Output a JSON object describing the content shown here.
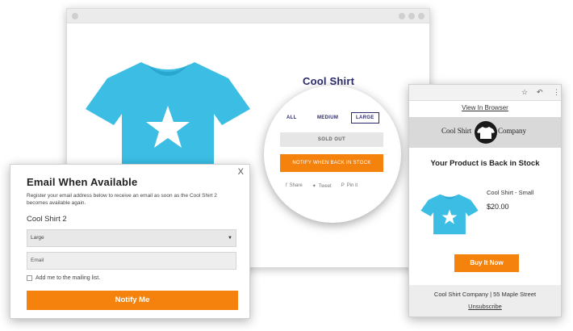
{
  "store": {
    "product_title": "Cool Shirt",
    "sizes": [
      "ALL",
      "MEDIUM",
      "LARGE"
    ],
    "sold_out_label": "SOLD OUT",
    "notify_label": "NOTIFY WHEN BACK IN STOCK",
    "share": [
      {
        "icon": "facebook-icon",
        "glyph": "f",
        "label": "Share"
      },
      {
        "icon": "twitter-icon",
        "glyph": "🐦",
        "label": "Tweet"
      },
      {
        "icon": "pinterest-icon",
        "glyph": "P",
        "label": "Pin it"
      }
    ]
  },
  "modal": {
    "close_label": "X",
    "title": "Email When Available",
    "description": "Register your email address below to receive an email as soon as the Cool Shirt 2 becomes available again.",
    "product_name": "Cool Shirt 2",
    "size_selected": "Large",
    "email_placeholder": "Email",
    "mailing_list_label": "Add me to the mailing list.",
    "submit_label": "Notify Me"
  },
  "email": {
    "view_in_browser": "View In Browser",
    "logo_left": "Cool Shirt",
    "logo_right": "Company",
    "heading": "Your Product is Back in Stock",
    "product_name": "Cool Shirt - Small",
    "price": "$20.00",
    "buy_label": "Buy It Now",
    "footer_address": "Cool Shirt Company | 55 Maple Street",
    "unsubscribe_label": "Unsubscribe"
  },
  "colors": {
    "accent": "#f5820d",
    "shirt": "#3bbde4",
    "title": "#2b2b6b"
  }
}
